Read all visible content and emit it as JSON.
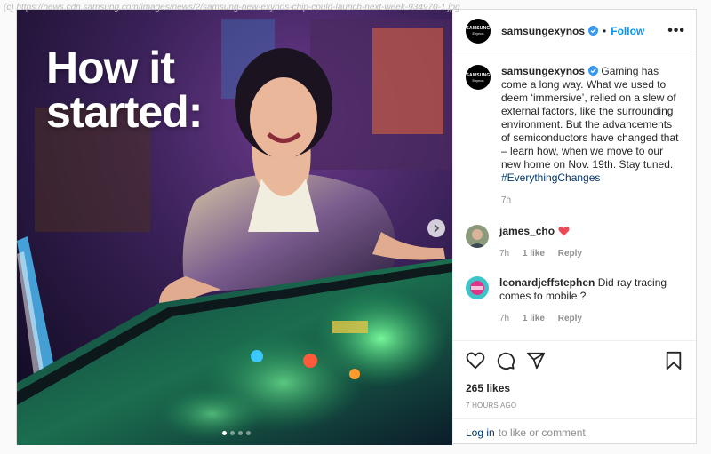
{
  "watermark": "(c) https://news.cdn.samsung.com/images/news/2/samsung-new-exynos-chip-could-launch-next-week-934970-1.jpg",
  "media": {
    "headline": "How it\nstarted:",
    "dots_total": 4,
    "dot_active": 0
  },
  "header": {
    "avatar_line1": "SAMSUNG",
    "avatar_line2": "Exynos",
    "username": "samsungexynos",
    "separator": "•",
    "follow": "Follow",
    "more": "•••"
  },
  "caption": {
    "username": "samsungexynos",
    "text": "Gaming has come a long way. What we used to deem ‘immersive’, relied on a slew of external factors, like the surrounding environment. But the advancements of semiconductors have changed that – learn how, when we move to our new home on Nov. 19th. Stay tuned. ",
    "hashtag": "#EverythingChanges",
    "time": "7h"
  },
  "comments": [
    {
      "username": "james_cho",
      "text": "",
      "time": "7h",
      "likes": "1 like",
      "reply": "Reply"
    },
    {
      "username": "leonardjeffstephen",
      "text": "Did ray tracing comes to mobile ?",
      "time": "7h",
      "likes": "1 like",
      "reply": "Reply"
    }
  ],
  "actions": {
    "likes": "265 likes",
    "posted": "7 HOURS AGO",
    "login_link": "Log in",
    "login_text": "to like or comment."
  },
  "colors": {
    "link": "#0095f6",
    "heart": "#ed4956",
    "verified": "#3897f0"
  }
}
